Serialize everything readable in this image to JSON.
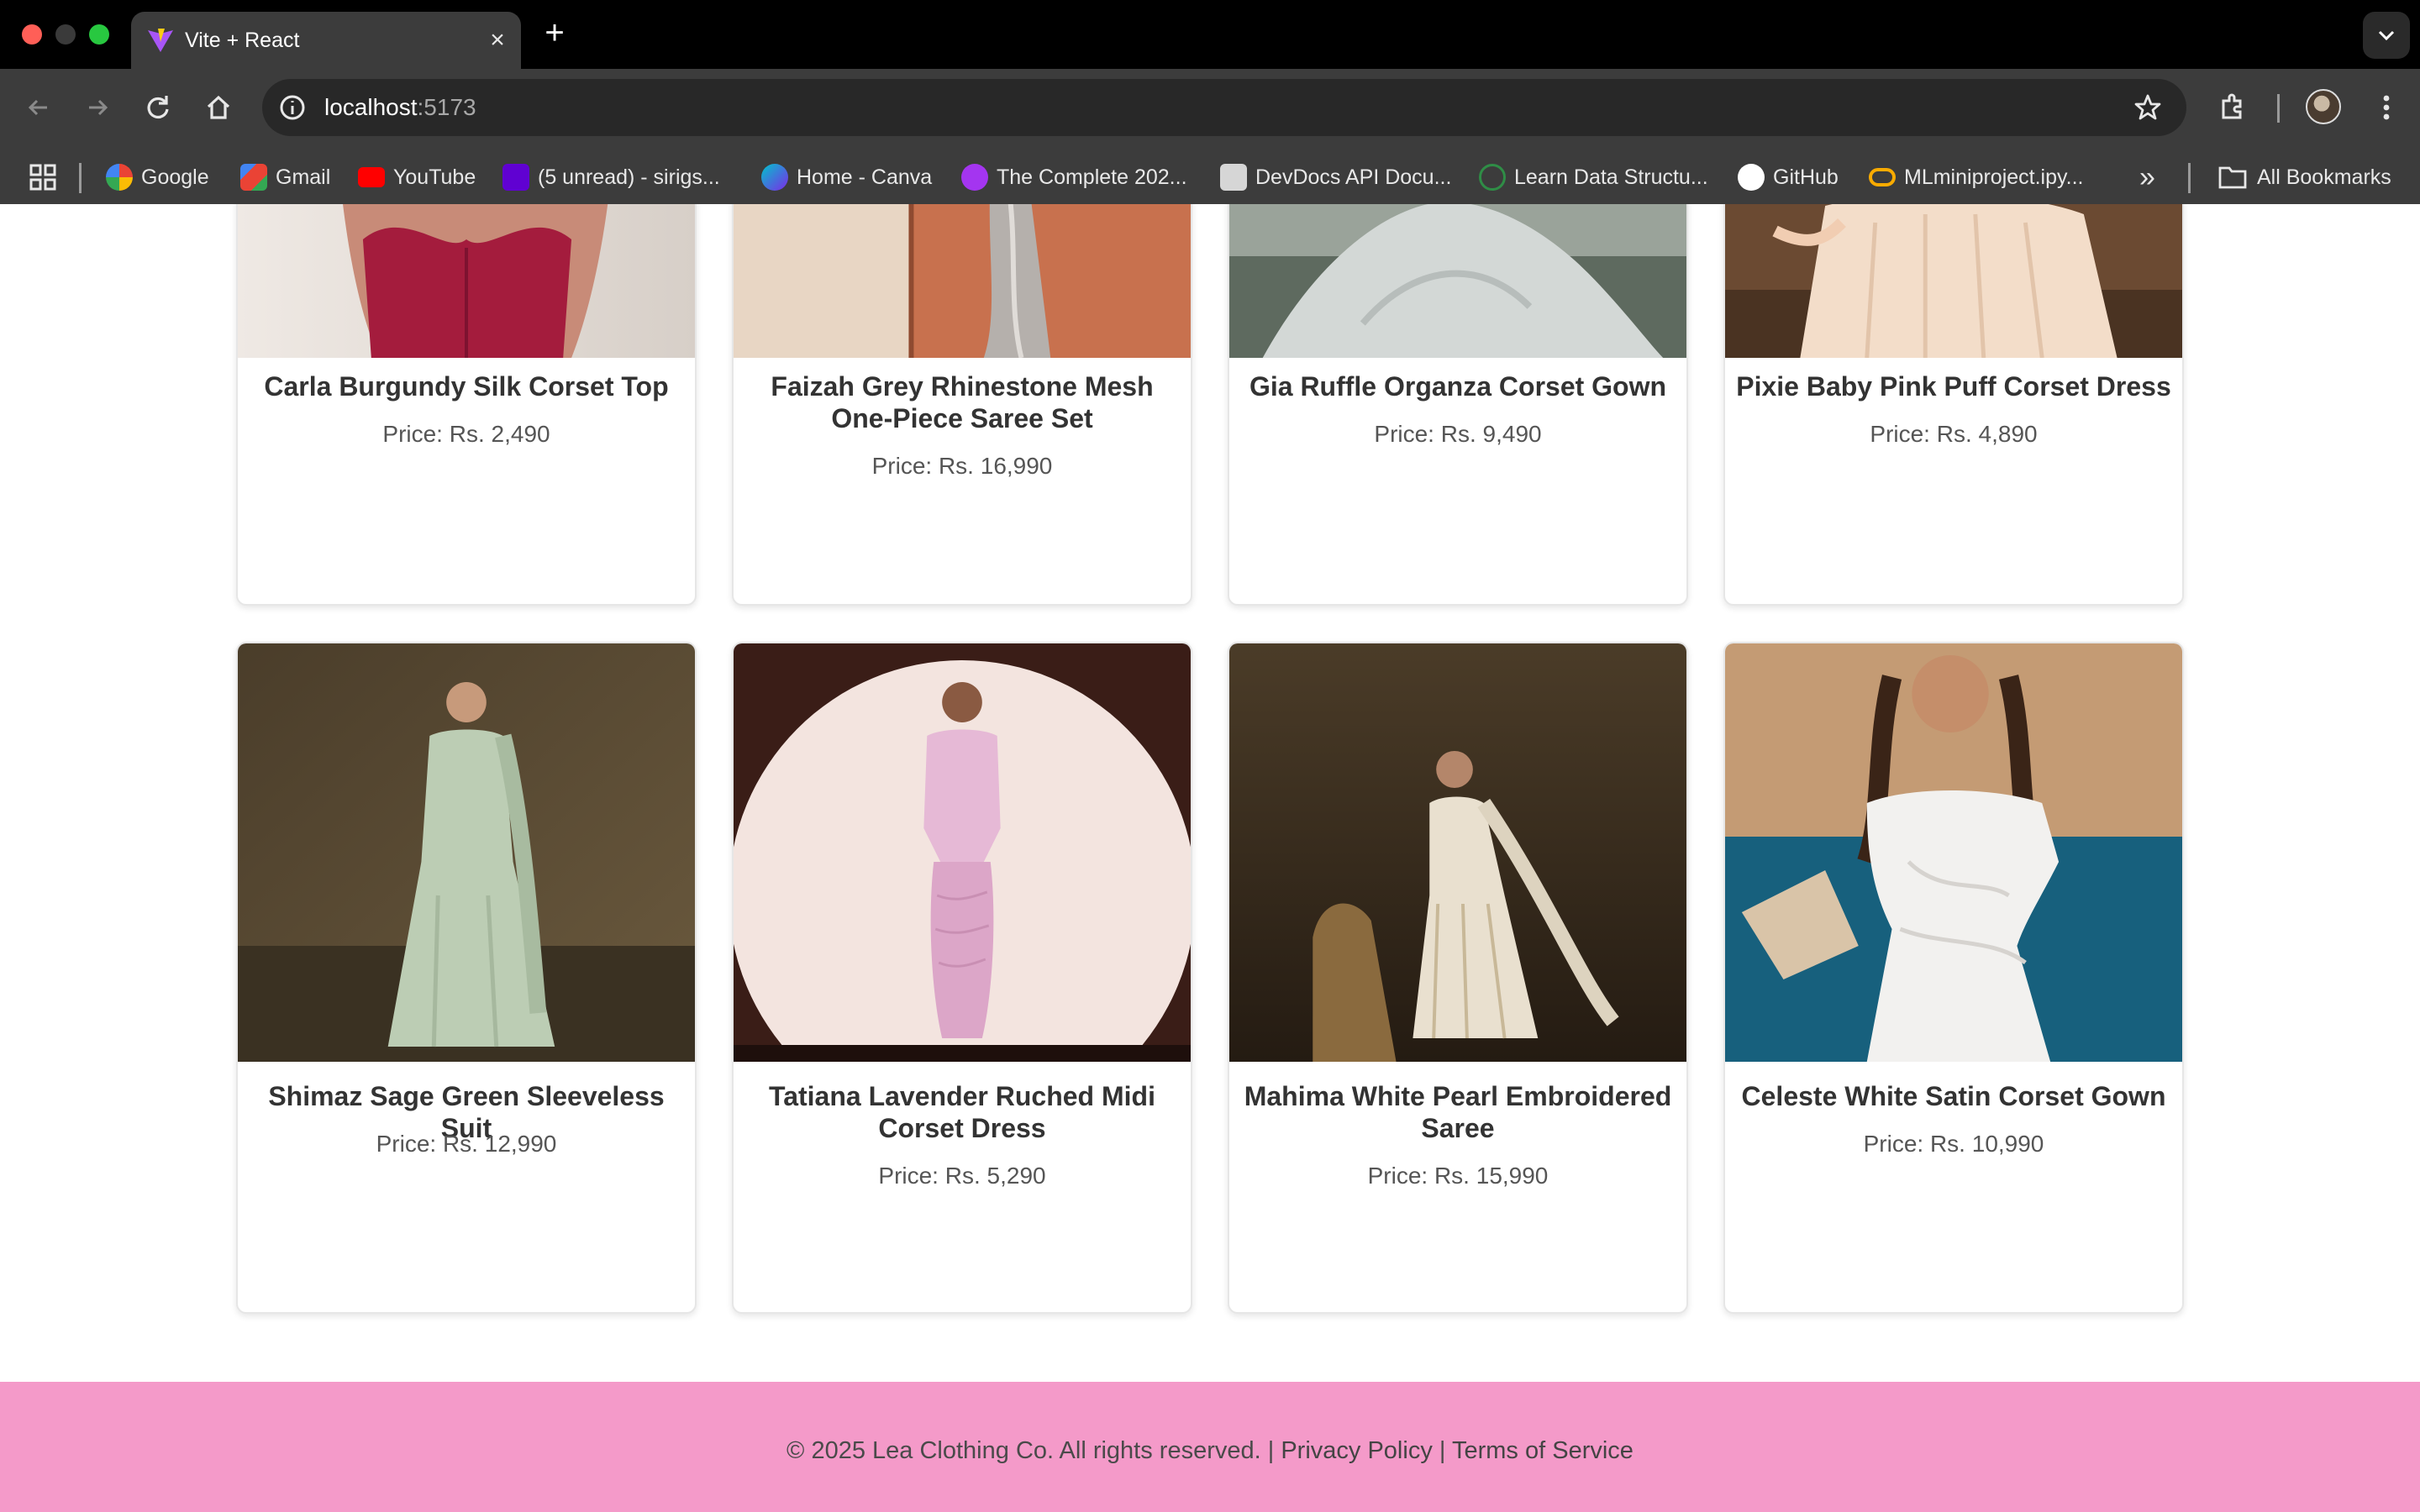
{
  "browser": {
    "tab_title": "Vite + React",
    "tab_close": "×",
    "new_tab": "+",
    "url_host": "localhost",
    "url_port": ":5173",
    "bookmarks": [
      {
        "label": "Google",
        "icon": "google-icon",
        "color": "#4285f4"
      },
      {
        "label": "Gmail",
        "icon": "gmail-icon",
        "color": "#ea4335"
      },
      {
        "label": "YouTube",
        "icon": "youtube-icon",
        "color": "#ff0000"
      },
      {
        "label": "(5 unread) - sirigs...",
        "icon": "yahoo-icon",
        "color": "#6001d2"
      },
      {
        "label": "Home - Canva",
        "icon": "canva-icon",
        "color": "#00c4cc"
      },
      {
        "label": "The Complete 202...",
        "icon": "udemy-icon",
        "color": "#a435f0"
      },
      {
        "label": "DevDocs API Docu...",
        "icon": "devdocs-icon",
        "color": "#d6d6d6"
      },
      {
        "label": "Learn Data Structu...",
        "icon": "gfg-icon",
        "color": "#2f8d46"
      },
      {
        "label": "GitHub",
        "icon": "github-icon",
        "color": "#ffffff"
      },
      {
        "label": "MLminiproject.ipy...",
        "icon": "colab-icon",
        "color": "#f9ab00"
      }
    ],
    "more_bookmarks": "»",
    "all_bookmarks": "All Bookmarks"
  },
  "products_row1": [
    {
      "name": "Carla Burgundy Silk Corset Top",
      "price": "Price: Rs. 2,490"
    },
    {
      "name": "Faizah Grey Rhinestone Mesh One-Piece Saree Set",
      "price": "Price: Rs. 16,990"
    },
    {
      "name": "Gia Ruffle Organza Corset Gown",
      "price": "Price: Rs. 9,490"
    },
    {
      "name": "Pixie Baby Pink Puff Corset Dress",
      "price": "Price: Rs. 4,890"
    }
  ],
  "products_row2": [
    {
      "name": "Shimaz Sage Green Sleeveless Suit",
      "price": "Price: Rs. 12,990"
    },
    {
      "name": "Tatiana Lavender Ruched Midi Corset Dress",
      "price": "Price: Rs. 5,290"
    },
    {
      "name": "Mahima White Pearl Embroidered Saree",
      "price": "Price: Rs. 15,990"
    },
    {
      "name": "Celeste White Satin Corset Gown",
      "price": "Price: Rs. 10,990"
    }
  ],
  "footer": {
    "copyright": "© 2025 Lea Clothing Co. All rights reserved. |",
    "privacy": "Privacy Policy",
    "divider": "|",
    "terms": "Terms of Service"
  },
  "colors": {
    "footer_bg": "#f49ac9",
    "chrome_bg": "#3c3c3c"
  }
}
